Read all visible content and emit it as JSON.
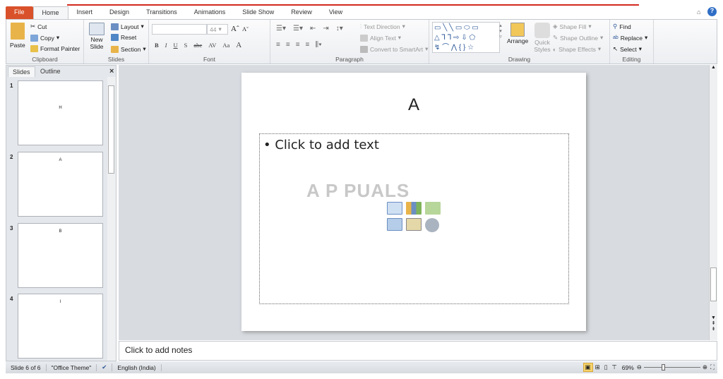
{
  "tabs": [
    "File",
    "Home",
    "Insert",
    "Design",
    "Transitions",
    "Animations",
    "Slide Show",
    "Review",
    "View"
  ],
  "clipboard": {
    "paste": "Paste",
    "cut": "Cut",
    "copy": "Copy",
    "format_painter": "Format Painter",
    "label": "Clipboard"
  },
  "slides_grp": {
    "new_slide": "New Slide",
    "layout": "Layout",
    "reset": "Reset",
    "section": "Section",
    "label": "Slides"
  },
  "font": {
    "size": "44",
    "label": "Font",
    "bold": "B",
    "italic": "I",
    "underline": "U",
    "shadow": "S",
    "strike": "abc",
    "spacing": "AV",
    "case": "Aa",
    "color": "A"
  },
  "paragraph": {
    "text_direction": "Text Direction",
    "align_text": "Align Text",
    "convert": "Convert to SmartArt",
    "label": "Paragraph"
  },
  "drawing": {
    "arrange": "Arrange",
    "quick_styles": "Quick Styles",
    "shape_fill": "Shape Fill",
    "shape_outline": "Shape Outline",
    "shape_effects": "Shape Effects",
    "label": "Drawing"
  },
  "editing": {
    "find": "Find",
    "replace": "Replace",
    "select": "Select",
    "label": "Editing"
  },
  "panel": {
    "tab_slides": "Slides",
    "tab_outline": "Outline",
    "close": "×"
  },
  "thumbs": [
    {
      "n": "1",
      "t": "H"
    },
    {
      "n": "2",
      "t": "A"
    },
    {
      "n": "3",
      "t": "B"
    },
    {
      "n": "4",
      "t": "I"
    }
  ],
  "slide": {
    "title": "A",
    "body": "Click to add text"
  },
  "watermark": "APPUALS",
  "notes": "Click to add notes",
  "status": {
    "slide": "Slide 6 of 6",
    "theme": "\"Office Theme\"",
    "lang": "English (India)",
    "zoom": "69%"
  },
  "zoom_level": 69
}
